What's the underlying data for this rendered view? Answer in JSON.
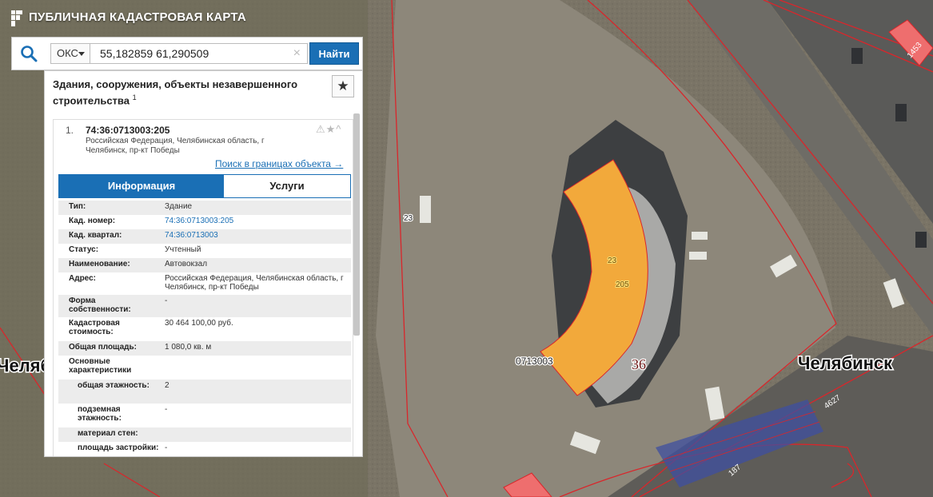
{
  "app": {
    "title": "ПУБЛИЧНАЯ КАДАСТРОВАЯ КАРТА"
  },
  "search": {
    "type_selected": "ОКС",
    "query": "55,182859 61,290509",
    "clear_icon": "×",
    "find_label": "Найти"
  },
  "panel": {
    "title": "Здания, сооружения, объекты незавершенного строительства",
    "count": "1",
    "favorite_icon": "star-icon",
    "result": {
      "index": "1.",
      "cad_number": "74:36:0713003:205",
      "address_short": "Российская Федерация, Челябинская область, г Челябинск, пр-кт Победы",
      "status_icons": "⚠★^",
      "search_in_bounds": "Поиск в границах объекта →"
    },
    "tabs": {
      "info": "Информация",
      "services": "Услуги"
    },
    "rows": [
      {
        "label": "Тип:",
        "value": "Здание"
      },
      {
        "label": "Кад. номер:",
        "value": "74:36:0713003:205"
      },
      {
        "label": "Кад. квартал:",
        "value": "74:36:0713003"
      },
      {
        "label": "Статус:",
        "value": "Учтенный"
      },
      {
        "label": "Наименование:",
        "value": "Автовокзал"
      },
      {
        "label": "Адрес:",
        "value": "Российская Федерация, Челябинская область, г Челябинск, пр-кт Победы"
      },
      {
        "label": "Форма собственности:",
        "value": "-"
      },
      {
        "label": "Кадастровая стоимость:",
        "value": "30 464 100,00 руб."
      },
      {
        "label": "Общая площадь:",
        "value": "1 080,0 кв. м"
      },
      {
        "label": "Основные характеристики",
        "value": ""
      },
      {
        "label": "общая этажность:",
        "value": "2"
      },
      {
        "label": "подземная этажность:",
        "value": "-"
      },
      {
        "label": "материал стен:",
        "value": ""
      },
      {
        "label": "площадь застройки:",
        "value": "-"
      }
    ]
  },
  "map": {
    "labels": {
      "city_left": "Челябі",
      "city_right": "Челябинск",
      "quarter": "0713003",
      "district": "36",
      "plot_23_left": "23",
      "plot_23": "23",
      "plot_205": "205",
      "tag_1453": "1453",
      "tag_4627": "4627",
      "tag_187": "187"
    },
    "colors": {
      "highlight": "#f2a93b",
      "boundary": "#d9262b",
      "brand_blue": "#1a6fb5"
    }
  }
}
